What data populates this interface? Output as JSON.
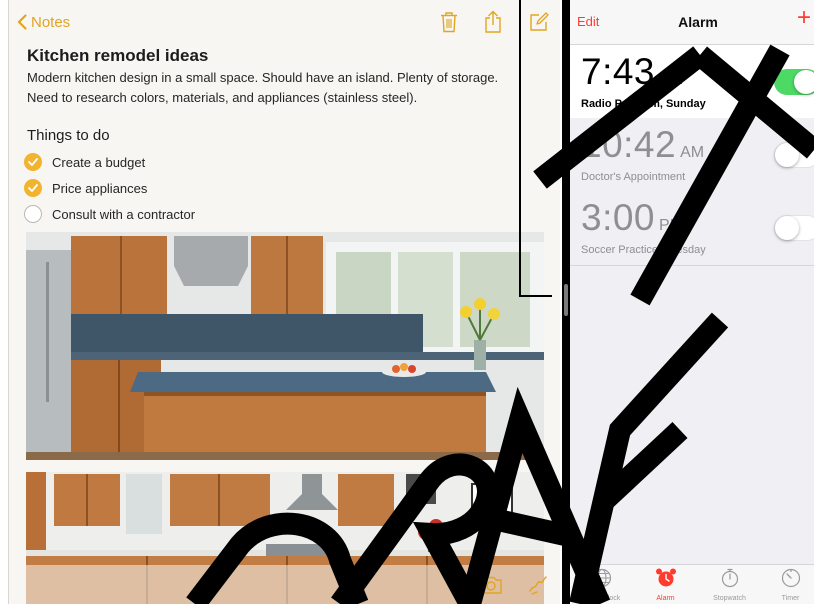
{
  "notes": {
    "back_label": "Notes",
    "title": "Kitchen remodel ideas",
    "body_line_1": "Modern kitchen design in a small space. Should have an island. Plenty of storage.",
    "body_line_2": "Need to research colors, materials, and appliances (stainless steel).",
    "section_heading": "Things to do",
    "checklist": [
      {
        "label": "Create a budget",
        "checked": true
      },
      {
        "label": "Price appliances",
        "checked": true
      },
      {
        "label": "Consult with a contractor",
        "checked": false
      }
    ],
    "accent_color": "#e1a521",
    "check_color": "#f2b32e",
    "icons": {
      "back": "chevron-left-icon",
      "delete": "trash-icon",
      "share": "share-icon",
      "compose": "compose-icon",
      "camera": "camera-icon",
      "sketch": "sketch-icon"
    }
  },
  "alarm": {
    "edit_label": "Edit",
    "title": "Alarm",
    "add_label": "+",
    "accent_color": "#ff3b30",
    "toggle_on_color": "#4cd964",
    "alarms": [
      {
        "time": "7:43",
        "ampm": "AM",
        "label": "Radio Program, Sunday",
        "enabled": true
      },
      {
        "time": "10:42",
        "ampm": "AM",
        "label": "Doctor's Appointment",
        "enabled": false
      },
      {
        "time": "3:00",
        "ampm": "PM",
        "label": "Soccer Practice, Tuesday",
        "enabled": false
      }
    ],
    "tabs": [
      {
        "label": "World Clock",
        "icon": "globe-icon",
        "active": false
      },
      {
        "label": "Alarm",
        "icon": "alarm-clock-icon",
        "active": true
      },
      {
        "label": "Stopwatch",
        "icon": "stopwatch-icon",
        "active": false
      },
      {
        "label": "Timer",
        "icon": "timer-icon",
        "active": false
      }
    ]
  }
}
